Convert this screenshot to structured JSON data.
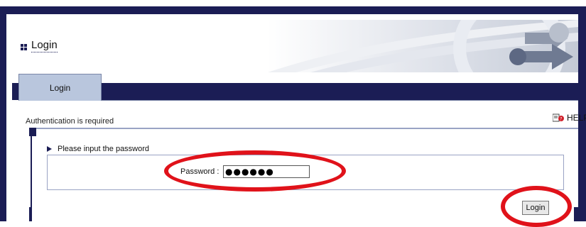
{
  "header": {
    "title": "Login",
    "icon": "grid-icon"
  },
  "tabs": [
    {
      "label": "Login",
      "active": true
    }
  ],
  "auth": {
    "message": "Authentication is required",
    "help_label": "HELP"
  },
  "form": {
    "prompt": "Please input the password",
    "password_label": "Password :",
    "password_value": "●●●●●●",
    "login_button": "Login"
  },
  "colors": {
    "navy": "#1b1d55",
    "tab": "#b9c6dd",
    "highlight": "#e0121a"
  }
}
